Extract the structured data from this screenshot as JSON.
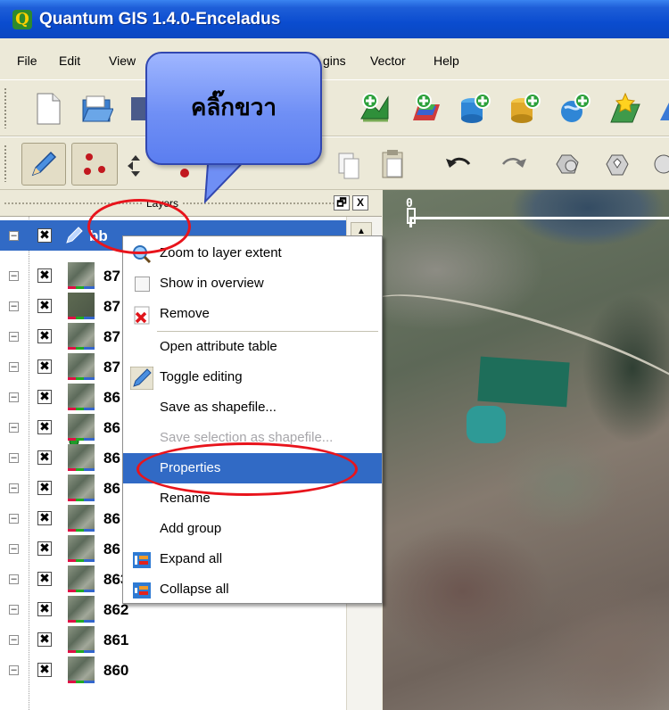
{
  "window": {
    "title": "Quantum GIS 1.4.0-Enceladus",
    "app_icon": "Q"
  },
  "menubar": {
    "items": [
      "File",
      "Edit",
      "View",
      "gins",
      "Vector",
      "Help"
    ]
  },
  "callout": {
    "text": "คลิ๊กขวา"
  },
  "layers_panel": {
    "title": "Layers",
    "float_button": "🗗",
    "close_button": "X",
    "layers": [
      {
        "name": "bb",
        "selected": true
      },
      {
        "name": "87"
      },
      {
        "name": "87"
      },
      {
        "name": "87"
      },
      {
        "name": "87"
      },
      {
        "name": "86"
      },
      {
        "name": "86"
      },
      {
        "name": "86"
      },
      {
        "name": "86"
      },
      {
        "name": "86"
      },
      {
        "name": "86"
      },
      {
        "name": "863"
      },
      {
        "name": "862"
      },
      {
        "name": "861"
      },
      {
        "name": "860"
      }
    ]
  },
  "map": {
    "scale_zero": "0"
  },
  "context_menu": {
    "items": [
      {
        "label": "Zoom to layer extent",
        "icon": "zoom-extent-icon"
      },
      {
        "label": "Show in overview",
        "icon": "checkbox-icon"
      },
      {
        "label": "Remove",
        "icon": "remove-icon"
      },
      {
        "label": "Open attribute table"
      },
      {
        "label": "Toggle editing",
        "icon": "pencil-icon"
      },
      {
        "label": "Save as shapefile..."
      },
      {
        "label": "Save selection as shapefile...",
        "disabled": true
      },
      {
        "label": "Properties",
        "highlighted": true
      },
      {
        "label": "Rename"
      },
      {
        "label": "Add group"
      },
      {
        "label": "Expand all",
        "icon": "expand-all-icon"
      },
      {
        "label": "Collapse all",
        "icon": "collapse-all-icon"
      }
    ]
  },
  "colors": {
    "selection": "#316ac5",
    "annotation_red": "#e8141c",
    "titlebar": "#0a4ccf"
  }
}
